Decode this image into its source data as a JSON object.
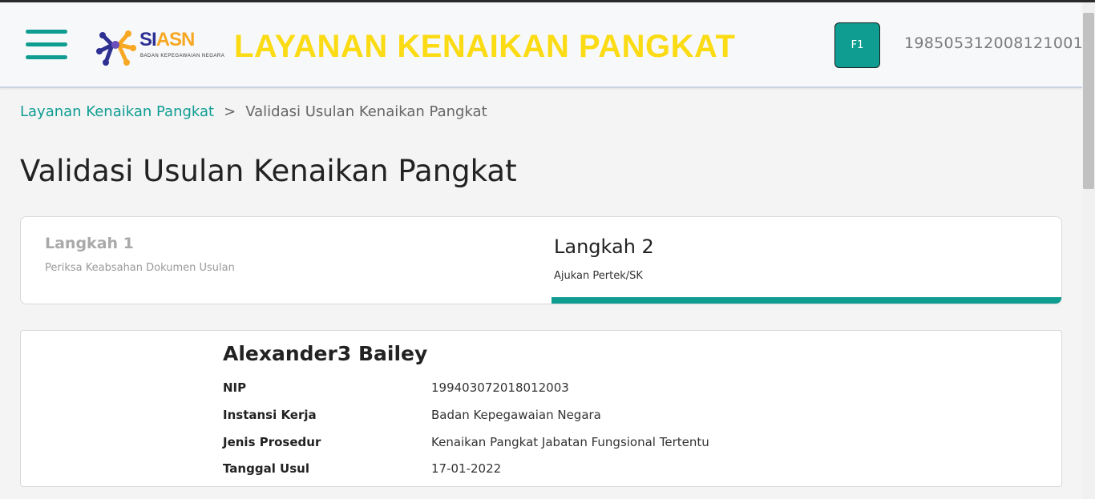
{
  "header": {
    "logo_text_main": "SI",
    "logo_text_accent": "ASN",
    "logo_subtext": "BADAN KEPEGAWAIAN NEGARA",
    "app_title": "LAYANAN KENAIKAN PANGKAT",
    "avatar_label": "F1",
    "user_id": "198505312008121001"
  },
  "breadcrumb": {
    "link": "Layanan Kenaikan Pangkat",
    "separator": ">",
    "current": "Validasi Usulan Kenaikan Pangkat"
  },
  "page": {
    "title": "Validasi Usulan Kenaikan Pangkat"
  },
  "steps": [
    {
      "title": "Langkah 1",
      "subtitle": "Periksa Keabsahan Dokumen Usulan"
    },
    {
      "title": "Langkah 2",
      "subtitle": "Ajukan Pertek/SK"
    }
  ],
  "detail": {
    "name": "Alexander3 Bailey",
    "rows": [
      {
        "label": "NIP",
        "value": "199403072018012003"
      },
      {
        "label": "Instansi Kerja",
        "value": "Badan Kepegawaian Negara"
      },
      {
        "label": "Jenis Prosedur",
        "value": "Kenaikan Pangkat Jabatan Fungsional Tertentu"
      },
      {
        "label": "Tanggal Usul",
        "value": "17-01-2022"
      }
    ]
  },
  "colors": {
    "accent": "#0f9d92",
    "title_yellow": "#fadb14",
    "logo_blue": "#2e3192",
    "logo_orange": "#f7a823"
  }
}
